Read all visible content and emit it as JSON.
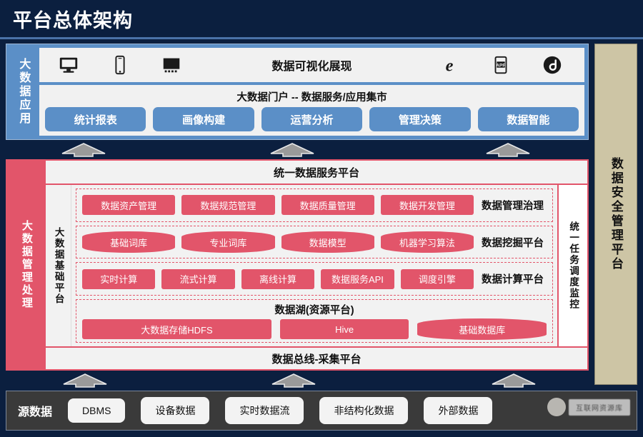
{
  "page": {
    "title": "平台总体架构"
  },
  "app_layer": {
    "sidebar_label": "大数据应用",
    "visualization": {
      "title": "数据可视化展现",
      "left_icons": [
        "monitor-icon",
        "mobile-phone-icon",
        "tablet-screen-icon"
      ],
      "right_icons": [
        "internet-explorer-icon",
        "app-icon",
        "wechat-miniprogram-icon"
      ]
    },
    "portal": {
      "title": "大数据门户 -- 数据服务/应用集市",
      "buttons": [
        "统计报表",
        "画像构建",
        "运营分析",
        "管理决策",
        "数据智能"
      ]
    }
  },
  "mgmt_layer": {
    "sidebar_label": "大数据管理处理",
    "unified_service_title": "统一数据服务平台",
    "base_platform_label": "大数据基础平台",
    "scheduling_label": "统一任务调度监控",
    "bus_title": "数据总线-采集平台",
    "groups": [
      {
        "label": "数据管理治理",
        "shape": "rect",
        "chips": [
          "数据资产管理",
          "数据规范管理",
          "数据质量管理",
          "数据开发管理"
        ]
      },
      {
        "label": "数据挖掘平台",
        "shape": "barrel",
        "chips": [
          "基础词库",
          "专业词库",
          "数据模型",
          "机器学习算法"
        ]
      },
      {
        "label": "数据计算平台",
        "shape": "rect",
        "chips": [
          "实时计算",
          "流式计算",
          "离线计算",
          "数据服务API",
          "调度引擎"
        ]
      }
    ],
    "data_lake": {
      "title": "数据湖(资源平台)",
      "chips": [
        {
          "label": "大数据存储HDFS",
          "shape": "rect",
          "weight": 3
        },
        {
          "label": "Hive",
          "shape": "rect",
          "weight": 2
        },
        {
          "label": "基础数据库",
          "shape": "barrel",
          "weight": 2
        }
      ]
    }
  },
  "security_panel": {
    "label": "数据安全管理平台"
  },
  "source_layer": {
    "label": "源数据",
    "chips": [
      "DBMS",
      "设备数据",
      "实时数据流",
      "非结构化数据",
      "外部数据"
    ]
  },
  "watermark": {
    "text": "互联网资源库"
  },
  "colors": {
    "background": "#0b1f3f",
    "blue": "#5b8fc7",
    "red": "#e2556a",
    "khaki": "#cdc5a5",
    "dark_gray": "#3a3a3a",
    "panel": "#f2f2f2"
  },
  "arrows": {
    "count": 3,
    "direction": "up"
  }
}
